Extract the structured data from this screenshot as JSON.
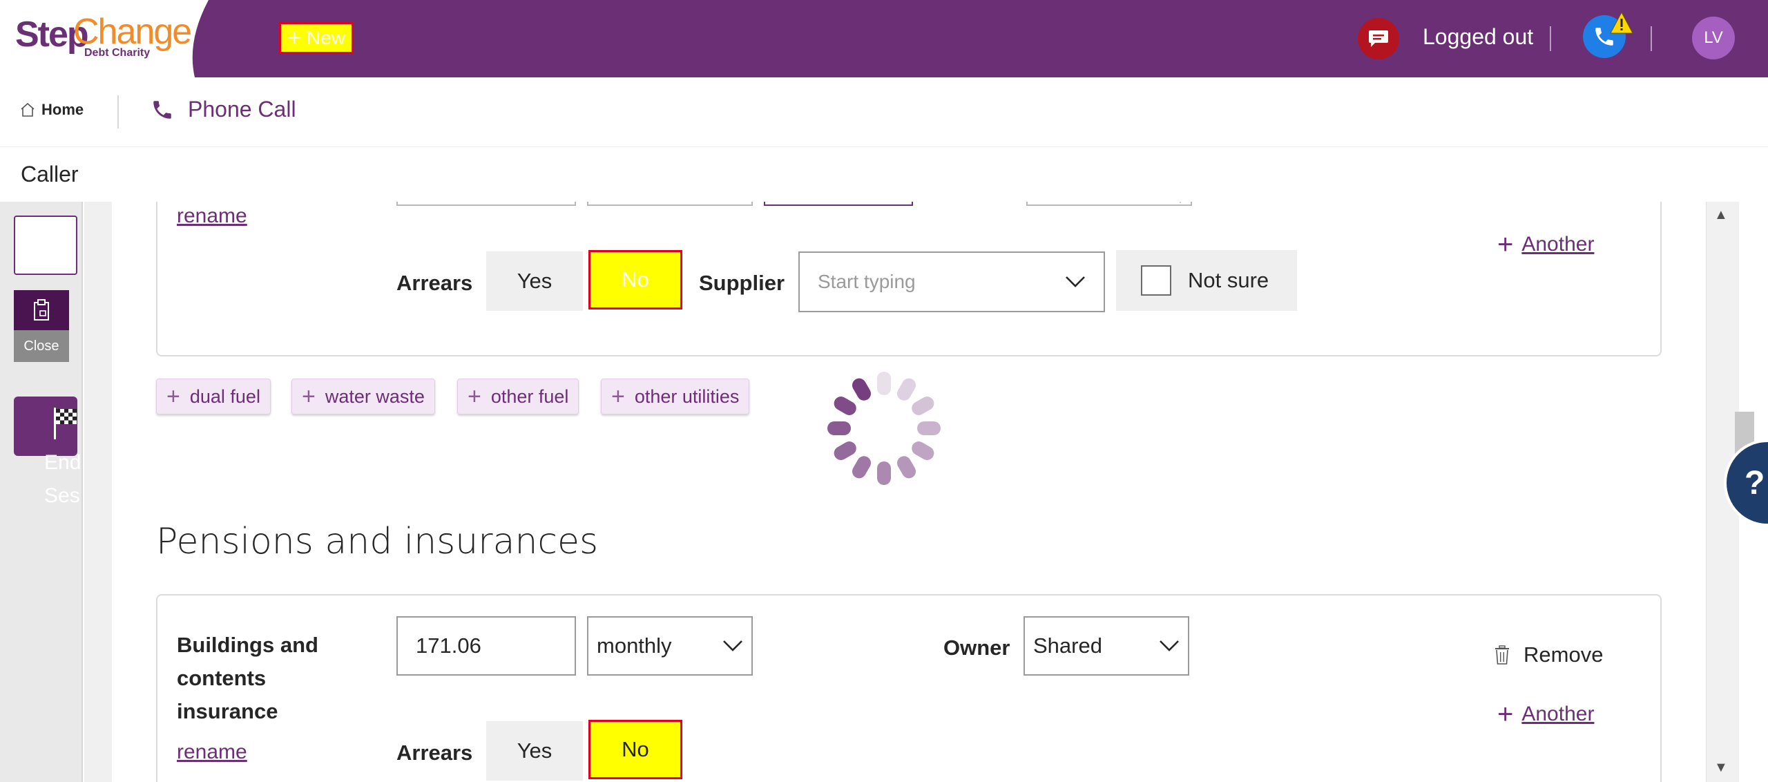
{
  "header": {
    "logo": {
      "step": "Step",
      "change": "Change",
      "sub": "Debt Charity"
    },
    "new_label": "New",
    "status": "Logged out",
    "avatar_initials": "LV",
    "brand_color": "#6b2f75"
  },
  "nav": {
    "home": "Home",
    "phone_call": "Phone Call"
  },
  "caller": {
    "label": "Caller"
  },
  "rail": {
    "close": "Close",
    "end_session": "End Session"
  },
  "utility": {
    "rename": "rename",
    "arrears": "Arrears",
    "yes": "Yes",
    "no": "No",
    "supplier": "Supplier",
    "supplier_placeholder": "Start typing",
    "not_sure": "Not sure",
    "another": "Another"
  },
  "chips": [
    "dual fuel",
    "water waste",
    "other fuel",
    "other utilities"
  ],
  "pensions": {
    "title": "Pensions and insurances",
    "item_label": "Buildings and contents insurance",
    "amount": "171.06",
    "frequency": "monthly",
    "owner_label": "Owner",
    "owner_value": "Shared",
    "remove": "Remove",
    "another": "Another",
    "rename": "rename",
    "arrears": "Arrears",
    "yes": "Yes",
    "no": "No"
  },
  "help": "?"
}
